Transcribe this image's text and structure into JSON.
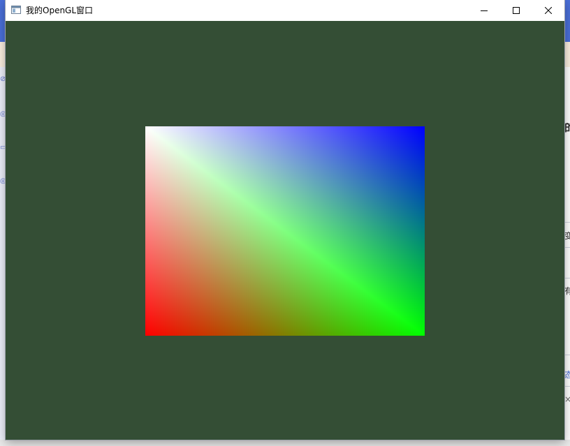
{
  "window": {
    "title": "我的OpenGL窗口",
    "app_icon": "window-app-icon",
    "controls": {
      "minimize_icon": "minimize-icon",
      "maximize_icon": "maximize-icon",
      "close_icon": "close-icon"
    }
  },
  "viewport": {
    "clear_color": "#344e35",
    "quad_corner_colors": {
      "top_left": "#ffffff",
      "top_right": "#0000ff",
      "bottom_left": "#ff0000",
      "bottom_right": "#00ff00"
    }
  },
  "background_app": {
    "accent": "#4a6fd8",
    "right_edge_text": [
      "的",
      "变",
      "有",
      "态",
      "×"
    ]
  }
}
